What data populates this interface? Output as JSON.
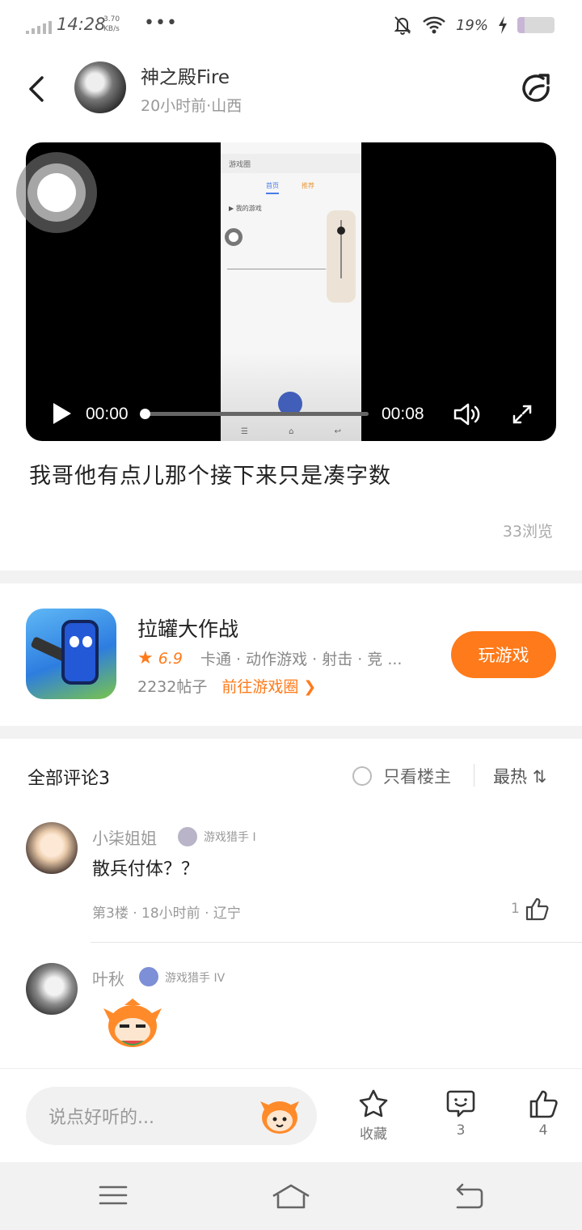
{
  "status_bar": {
    "time": "14:28",
    "net_speed": "3.70",
    "net_unit": "KB/s",
    "more": "•••",
    "battery_pct": "19%",
    "battery_level": 0.19
  },
  "header": {
    "author_name": "神之殿Fire",
    "author_meta": "20小时前·山西"
  },
  "video": {
    "current_time": "00:00",
    "total_time": "00:08",
    "progress": 0.0,
    "inner_app": {
      "title": "游戏圈",
      "tab_active": "首页",
      "tab_other": "推荐",
      "row": "我的游戏"
    }
  },
  "post": {
    "text": "我哥他有点儿那个接下来只是凑字数",
    "views": "33浏览"
  },
  "game": {
    "name": "拉罐大作战",
    "rating": "6.9",
    "tags": "卡通 · 动作游戏 · 射击 · 竞 ...",
    "posts": "2232帖子",
    "circle_link": "前往游戏圈",
    "play_label": "玩游戏"
  },
  "comments_section": {
    "title": "全部评论3",
    "only_op": "只看楼主",
    "sort": "最热"
  },
  "comments": [
    {
      "name": "小柒姐姐",
      "level": "游戏猎手 I",
      "text": "散兵付体？？",
      "meta": "第3楼 · 18小时前 · 辽宁",
      "likes": "1"
    },
    {
      "name": "叶秋",
      "level": "游戏猎手 IV"
    }
  ],
  "bottom_bar": {
    "input_placeholder": "说点好听的...",
    "favorite_label": "收藏",
    "comment_count": "3",
    "like_count": "4"
  },
  "colors": {
    "accent": "#ff7a1a",
    "text": "#222222",
    "muted": "#999999",
    "divider": "#f2f2f2"
  }
}
